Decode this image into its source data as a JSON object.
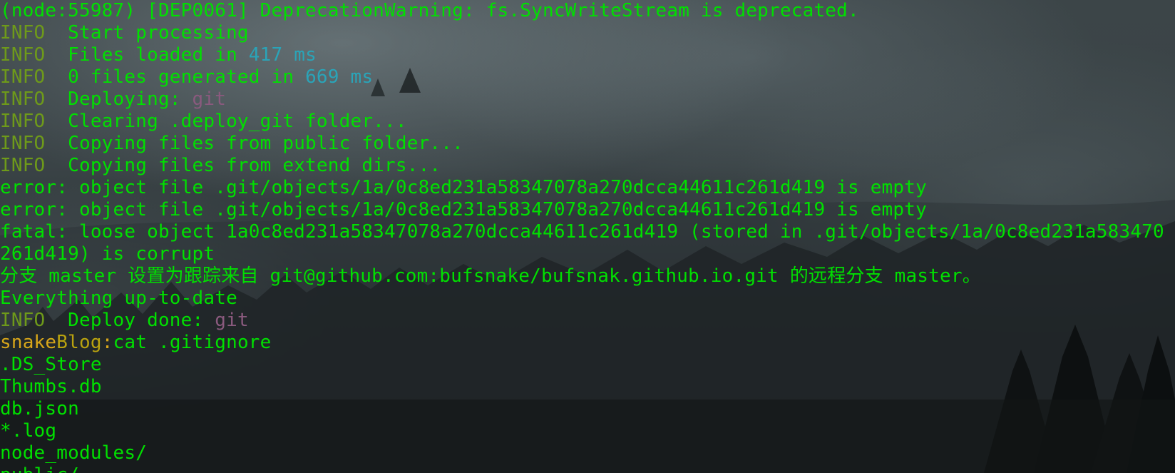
{
  "colors": {
    "green": "#00e000",
    "info": "#6e9a1a",
    "number": "#2aa4b8",
    "deployer": "#8a5a7e",
    "prompt_user": "#d8a61a",
    "prompt_host": "#b9a20f"
  },
  "terminal": {
    "lines": [
      {
        "kind": "warning",
        "text": "(node:55987) [DEP0061] DeprecationWarning: fs.SyncWriteStream is deprecated."
      },
      {
        "kind": "info",
        "level": "INFO",
        "text": "Start processing"
      },
      {
        "kind": "info-num",
        "level": "INFO",
        "pre": "Files loaded in ",
        "num": "417 ms"
      },
      {
        "kind": "info-num",
        "level": "INFO",
        "pre": "0 files generated in ",
        "num": "669 ms"
      },
      {
        "kind": "info-git",
        "level": "INFO",
        "pre": "Deploying: ",
        "deployer": "git"
      },
      {
        "kind": "info",
        "level": "INFO",
        "text": "Clearing .deploy_git folder..."
      },
      {
        "kind": "info",
        "level": "INFO",
        "text": "Copying files from public folder..."
      },
      {
        "kind": "info",
        "level": "INFO",
        "text": "Copying files from extend dirs..."
      },
      {
        "kind": "plain",
        "text": "error: object file .git/objects/1a/0c8ed231a58347078a270dcca44611c261d419 is empty"
      },
      {
        "kind": "plain",
        "text": "error: object file .git/objects/1a/0c8ed231a58347078a270dcca44611c261d419 is empty"
      },
      {
        "kind": "plain",
        "text": "fatal: loose object 1a0c8ed231a58347078a270dcca44611c261d419 (stored in .git/objects/1a/0c8ed231a583470"
      },
      {
        "kind": "plain",
        "text": "261d419) is corrupt"
      },
      {
        "kind": "plain",
        "text": "分支 master 设置为跟踪来自 git@github.com:bufsnake/bufsnak.github.io.git 的远程分支 master。"
      },
      {
        "kind": "plain",
        "text": "Everything up-to-date"
      },
      {
        "kind": "info-git",
        "level": "INFO",
        "pre": "Deploy done: ",
        "deployer": "git"
      },
      {
        "kind": "prompt",
        "user": "snake",
        "host": "Blog",
        "sep": ":",
        "command": "cat .gitignore"
      },
      {
        "kind": "plain",
        "text": ".DS_Store"
      },
      {
        "kind": "plain",
        "text": "Thumbs.db"
      },
      {
        "kind": "plain",
        "text": "db.json"
      },
      {
        "kind": "plain",
        "text": "*.log"
      },
      {
        "kind": "plain",
        "text": "node_modules/"
      },
      {
        "kind": "plain",
        "text": "public/"
      }
    ]
  }
}
